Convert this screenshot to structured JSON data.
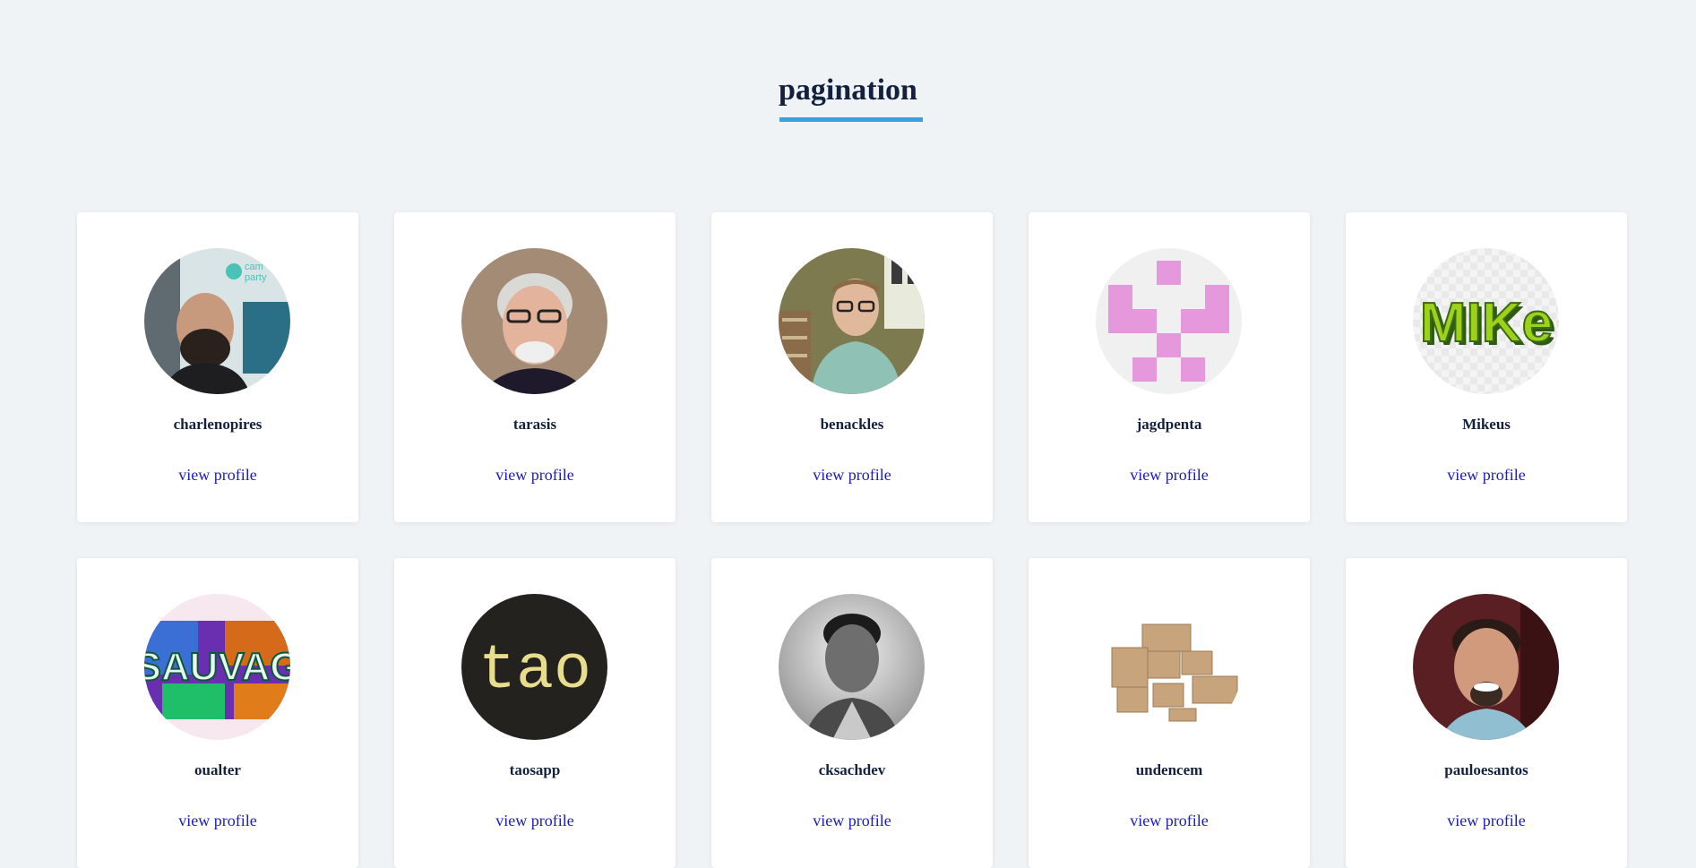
{
  "page": {
    "title": "pagination"
  },
  "colors": {
    "title": "#14213d",
    "underline": "#3a9fe0",
    "link": "#1a1ac8",
    "background": "#f0f3f6"
  },
  "profiles": [
    {
      "username": "charlenopires",
      "link_label": "view profile",
      "avatar": "photo-man-beard"
    },
    {
      "username": "tarasis",
      "link_label": "view profile",
      "avatar": "photo-man-glasses-white-hair"
    },
    {
      "username": "benackles",
      "link_label": "view profile",
      "avatar": "photo-man-glasses-office"
    },
    {
      "username": "jagdpenta",
      "link_label": "view profile",
      "avatar": "identicon-pink"
    },
    {
      "username": "Mikeus",
      "link_label": "view profile",
      "avatar": "logo-mike"
    },
    {
      "username": "oualter",
      "link_label": "view profile",
      "avatar": "graffiti-sauvag"
    },
    {
      "username": "taosapp",
      "link_label": "view profile",
      "avatar": "logo-tao"
    },
    {
      "username": "cksachdev",
      "link_label": "view profile",
      "avatar": "photo-man-bw"
    },
    {
      "username": "undencem",
      "link_label": "view profile",
      "avatar": "photo-boxes"
    },
    {
      "username": "pauloesantos",
      "link_label": "view profile",
      "avatar": "photo-man-smiling"
    }
  ]
}
